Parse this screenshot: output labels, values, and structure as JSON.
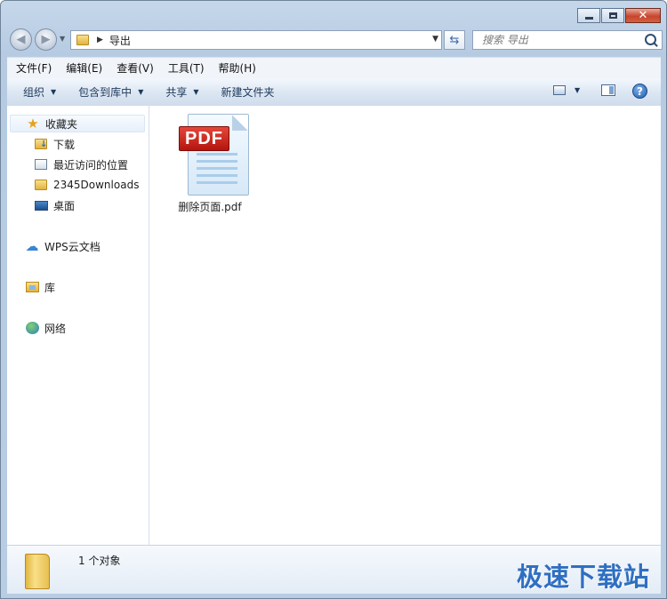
{
  "window": {
    "close_glyph": "✕"
  },
  "navigation": {
    "back_glyph": "◀",
    "forward_glyph": "▶",
    "address_path": "导出",
    "refresh_glyph": "⇆",
    "search_placeholder": "搜索 导出"
  },
  "menu": {
    "items": [
      "文件(F)",
      "编辑(E)",
      "查看(V)",
      "工具(T)",
      "帮助(H)"
    ]
  },
  "commands": {
    "organize": "组织",
    "include_library": "包含到库中",
    "share": "共享",
    "new_folder": "新建文件夹",
    "help_glyph": "?"
  },
  "nav_pane": {
    "favorites": "收藏夹",
    "downloads": "下载",
    "recent": "最近访问的位置",
    "downloads2345": "2345Downloads",
    "desktop": "桌面",
    "wps_cloud": "WPS云文档",
    "libraries": "库",
    "network": "网络"
  },
  "files": [
    {
      "name": "删除页面.pdf",
      "badge": "PDF",
      "icon": "pdf-file-icon"
    }
  ],
  "details": {
    "count": "1 个对象"
  },
  "watermark": "极速下载站",
  "colors": {
    "accent": "#2f6fc2",
    "pdf_red": "#c8201a",
    "close_red": "#c8452e"
  }
}
